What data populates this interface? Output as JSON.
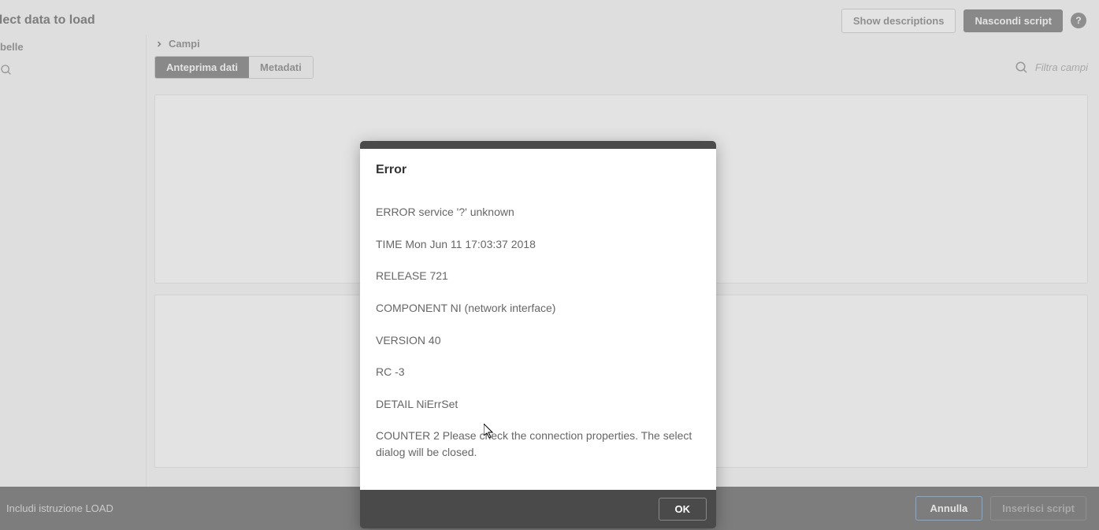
{
  "header": {
    "title": "elect data to load",
    "show_descriptions": "Show descriptions",
    "hide_script": "Nascondi script"
  },
  "left": {
    "label": "belle"
  },
  "right": {
    "label": "Campi",
    "tabs": {
      "preview": "Anteprima dati",
      "metadata": "Metadati"
    },
    "filter_placeholder": "Filtra campi"
  },
  "footer": {
    "include_load": "Includi istruzione LOAD",
    "cancel": "Annulla",
    "insert": "Inserisci script"
  },
  "dialog": {
    "title": "Error",
    "line1": "ERROR service '?' unknown",
    "line2": "TIME Mon Jun 11 17:03:37 2018",
    "line3": "RELEASE 721",
    "line4": "COMPONENT NI (network interface)",
    "line5": "VERSION 40",
    "line6": "RC -3",
    "line7": "DETAIL NiErrSet",
    "line8": "COUNTER 2 Please check the connection properties. The select dialog will be closed.",
    "ok": "OK"
  }
}
